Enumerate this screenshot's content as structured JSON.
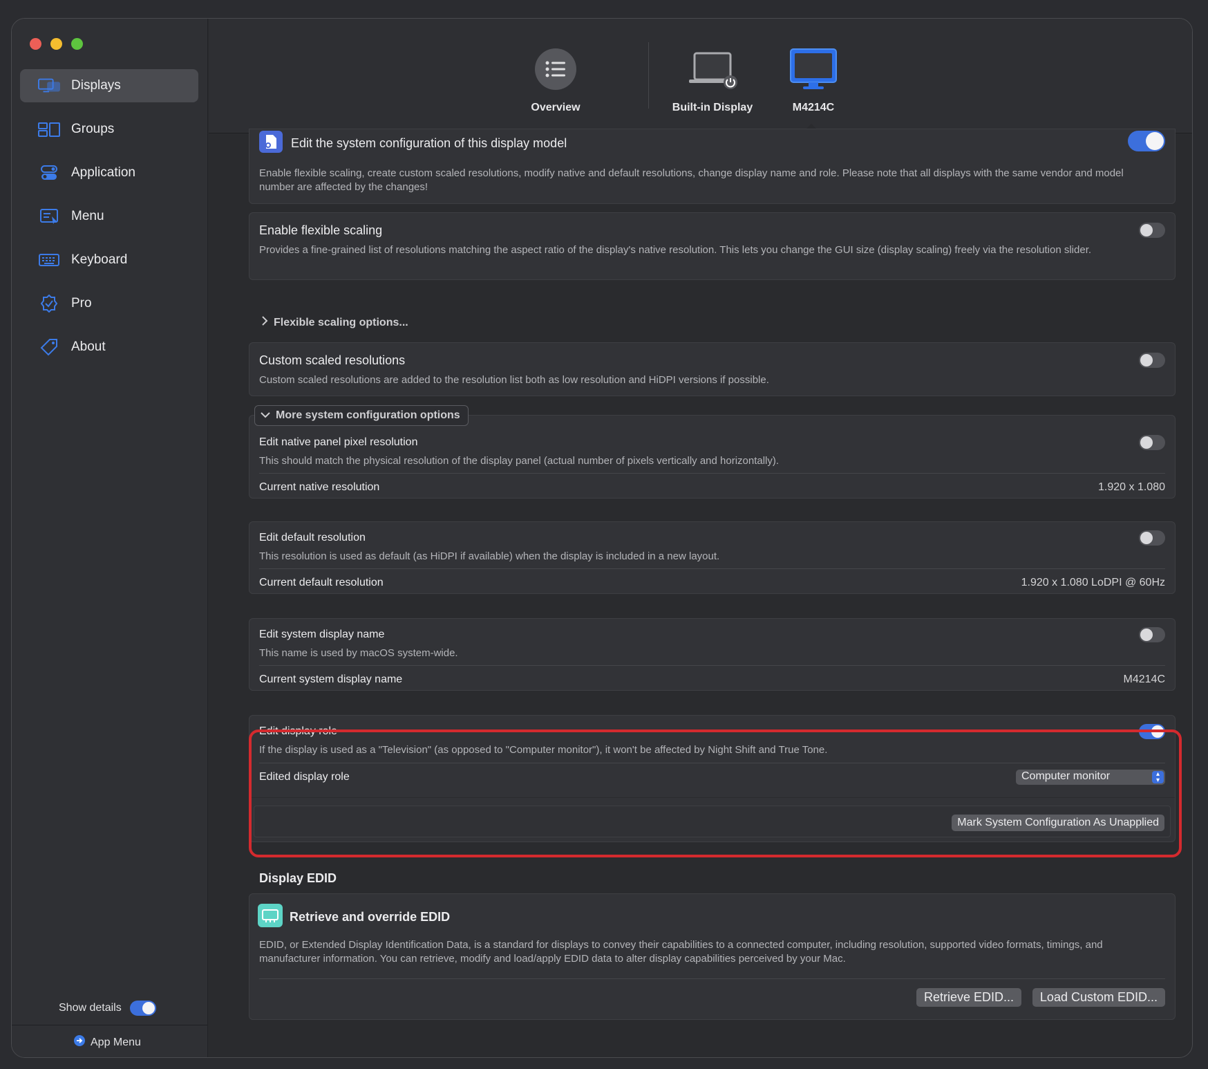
{
  "sidebar": {
    "items": [
      {
        "label": "Displays",
        "icon": "displays-icon",
        "active": true
      },
      {
        "label": "Groups",
        "icon": "groups-icon"
      },
      {
        "label": "Application",
        "icon": "application-icon"
      },
      {
        "label": "Menu",
        "icon": "menu-icon"
      },
      {
        "label": "Keyboard",
        "icon": "keyboard-icon"
      },
      {
        "label": "Pro",
        "icon": "pro-badge-icon"
      },
      {
        "label": "About",
        "icon": "tag-icon"
      }
    ],
    "show_details_label": "Show details",
    "show_details_on": true,
    "app_menu_label": "App Menu"
  },
  "toolbar": {
    "tabs": [
      {
        "label": "Overview",
        "icon": "list-icon"
      },
      {
        "label": "Built-in Display",
        "icon": "laptop-icon"
      },
      {
        "label": "M4214C",
        "icon": "monitor-icon",
        "selected": true
      }
    ]
  },
  "system_config": {
    "title": "Edit the system configuration of this display model",
    "desc": "Enable flexible scaling, create custom scaled resolutions, modify native and default resolutions, change display name and role. Please note that all displays with the same vendor and model number are affected by the changes!",
    "enabled": true
  },
  "flexible_scaling": {
    "title": "Enable flexible scaling",
    "desc": "Provides a fine-grained list of resolutions matching the aspect ratio of the display's native resolution. This lets you change the GUI size (display scaling) freely via the resolution slider.",
    "options_label": "Flexible scaling options..."
  },
  "custom_scaled": {
    "title": "Custom scaled resolutions",
    "desc": "Custom scaled resolutions are added to the resolution list both as low resolution and HiDPI versions if possible."
  },
  "more_options_label": "More system configuration options",
  "native_res": {
    "title": "Edit native panel pixel resolution",
    "desc": "This should match the physical resolution of the display panel (actual number of pixels vertically and horizontally).",
    "current_label": "Current native resolution",
    "current_value": "1.920 x 1.080"
  },
  "default_res": {
    "title": "Edit default resolution",
    "desc": "This resolution is used as default (as HiDPI if available) when the display is included in a new layout.",
    "current_label": "Current default resolution",
    "current_value": "1.920 x 1.080 LoDPI @ 60Hz"
  },
  "display_name": {
    "title": "Edit system display name",
    "desc": "This name is used by macOS system-wide.",
    "current_label": "Current system display name",
    "current_value": "M4214C"
  },
  "display_role": {
    "title": "Edit display role",
    "desc": "If the display is used as a \"Television\" (as opposed to \"Computer monitor\"), it won't be affected by Night Shift and True Tone.",
    "enabled": true,
    "edited_label": "Edited display role",
    "edited_value": "Computer monitor",
    "mark_button": "Mark System Configuration As Unapplied"
  },
  "edid": {
    "section_title": "Display EDID",
    "title": "Retrieve and override EDID",
    "desc": "EDID, or Extended Display Identification Data, is a standard for displays to convey their capabilities to a connected computer, including resolution, supported video formats, timings, and manufacturer information. You can retrieve, modify and load/apply EDID data to alter display capabilities perceived by your Mac.",
    "retrieve_button": "Retrieve EDID...",
    "load_button": "Load Custom EDID..."
  },
  "colors": {
    "accent": "#3c6fdc",
    "highlight": "#d42a2e",
    "close": "#ed5f57",
    "minimize": "#f5bd2f",
    "zoom": "#5ec43f"
  }
}
